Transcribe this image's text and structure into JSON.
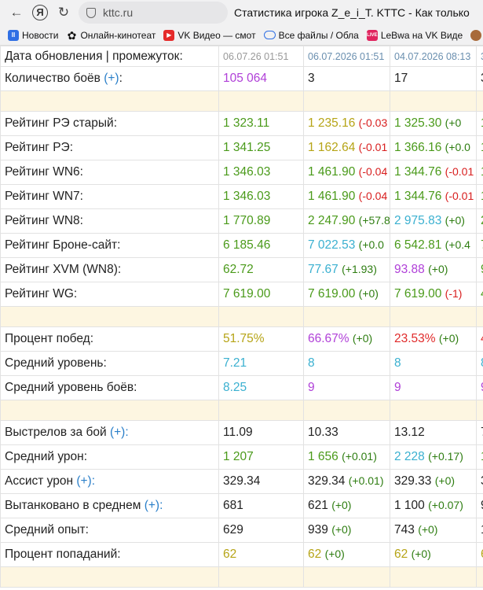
{
  "browser": {
    "url": "kttc.ru",
    "title": "Статистика игрока Z_e_i_T. KTTC - Как только",
    "bookmarks": [
      {
        "label": "Новости",
        "icon": "news-icon"
      },
      {
        "label": "Онлайн-кинотеат",
        "icon": "kinopoisk-icon"
      },
      {
        "label": "VK Видео — смот",
        "icon": "vk-video-icon"
      },
      {
        "label": "Все файлы / Обла",
        "icon": "cloud-icon"
      },
      {
        "label": "LeBwa на VK Виде",
        "icon": "live-icon"
      },
      {
        "label": "",
        "icon": "avatar-icon"
      }
    ]
  },
  "colors": {
    "green": "#4a9a1a",
    "olive": "#b6a416",
    "cyan": "#3ab0d0",
    "purple": "#b040d8",
    "red": "#e02a2a",
    "separator": "#fdf6e1",
    "link": "#2a7fc9"
  },
  "header": {
    "label": "Дата обновления | промежуток:",
    "cols": [
      "06.07.26 01:51",
      "06.07.2026 01:51",
      "04.07.2026 08:13",
      "3"
    ]
  },
  "battles": {
    "label": "Количество боёв",
    "plus": "(+)",
    "cols": [
      "105 064",
      "3",
      "17",
      "3"
    ]
  },
  "ratings": [
    {
      "label": "Рейтинг РЭ старый:",
      "c1": "1 323.11",
      "c2": "1 235.16",
      "c2d": "(-0.03",
      "c3": "1 325.30",
      "c3d": "(+0",
      "c4": "1"
    },
    {
      "label": "Рейтинг РЭ:",
      "c1": "1 341.25",
      "c2": "1 162.64",
      "c2d": "(-0.01",
      "c3": "1 366.16",
      "c3d": "(+0.0",
      "c4": "1"
    },
    {
      "label": "Рейтинг WN6:",
      "c1": "1 346.03",
      "c2": "1 461.90",
      "c2d": "(-0.04",
      "c3": "1 344.76",
      "c3d": "(-0.01",
      "c4": "1"
    },
    {
      "label": "Рейтинг WN7:",
      "c1": "1 346.03",
      "c2": "1 461.90",
      "c2d": "(-0.04",
      "c3": "1 344.76",
      "c3d": "(-0.01",
      "c4": "1"
    },
    {
      "label": "Рейтинг WN8:",
      "c1": "1 770.89",
      "c2": "2 247.90",
      "c2d": "(+57.8",
      "c3": "2 975.83",
      "c3d": "(+0)",
      "c4": "2"
    },
    {
      "label": "Рейтинг Броне-сайт:",
      "c1": "6 185.46",
      "c2": "7 022.53",
      "c2d": "(+0.0",
      "c3": "6 542.81",
      "c3d": "(+0.4",
      "c4": "7"
    },
    {
      "label": "Рейтинг XVM (WN8):",
      "c1": "62.72",
      "c2": "77.67",
      "c2d": "(+1.93)",
      "c3": "93.88",
      "c3d": "(+0)",
      "c4": "9"
    },
    {
      "label": "Рейтинг WG:",
      "c1": "7 619.00",
      "c2": "7 619.00",
      "c2d": "(+0)",
      "c3": "7 619.00",
      "c3d": "(-1)",
      "c4": "4"
    }
  ],
  "winstats": [
    {
      "label": "Процент побед:",
      "c1": "51.75%",
      "c2": "66.67%",
      "c2d": "(+0)",
      "c3": "23.53%",
      "c3d": "(+0)",
      "c4": "4"
    },
    {
      "label": "Средний уровень:",
      "c1": "7.21",
      "c2": "8",
      "c2d": "",
      "c3": "8",
      "c3d": "",
      "c4": "8"
    },
    {
      "label": "Средний уровень боёв:",
      "c1": "8.25",
      "c2": "9",
      "c2d": "",
      "c3": "9",
      "c3d": "",
      "c4": "9"
    }
  ],
  "battlestats": [
    {
      "label": "Выстрелов за бой",
      "plus": "(+):",
      "c1": "11.09",
      "c2": "10.33",
      "c2d": "",
      "c3": "13.12",
      "c3d": "",
      "c4": "7"
    },
    {
      "label": "Средний урон:",
      "plus": "",
      "c1": "1 207",
      "c2": "1 656",
      "c2d": "(+0.01)",
      "c3": "2 228",
      "c3d": "(+0.17)",
      "c4": "1"
    },
    {
      "label": "Ассист урон",
      "plus": "(+):",
      "c1": "329.34",
      "c2": "329.34",
      "c2d": "(+0.01)",
      "c3": "329.33",
      "c3d": "(+0)",
      "c4": "3"
    },
    {
      "label": "Вытанковано в среднем",
      "plus": "(+):",
      "c1": "681",
      "c2": "621",
      "c2d": "(+0)",
      "c3": "1 100",
      "c3d": "(+0.07)",
      "c4": "9"
    },
    {
      "label": "Средний опыт:",
      "plus": "",
      "c1": "629",
      "c2": "939",
      "c2d": "(+0)",
      "c3": "743",
      "c3d": "(+0)",
      "c4": "1"
    },
    {
      "label": "Процент попаданий:",
      "plus": "",
      "c1": "62",
      "c2": "62",
      "c2d": "(+0)",
      "c3": "62",
      "c3d": "(+0)",
      "c4": "6"
    }
  ]
}
